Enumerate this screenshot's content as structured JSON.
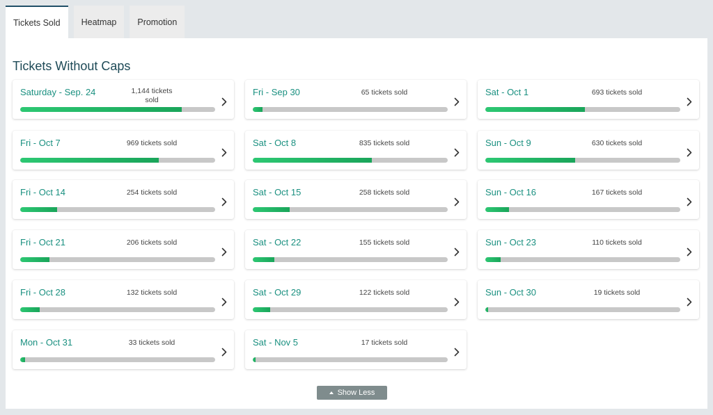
{
  "tabs": [
    {
      "label": "Tickets Sold",
      "active": true
    },
    {
      "label": "Heatmap",
      "active": false
    },
    {
      "label": "Promotion",
      "active": false
    }
  ],
  "section_title": "Tickets Without Caps",
  "colors": {
    "accent": "#1a9080",
    "bar_fill": "#22b865",
    "bar_track": "#c8c8c8",
    "button": "#7f8c8d"
  },
  "cards": [
    {
      "date": "Saturday - Sep. 24",
      "count_label": "1,144 tickets sold",
      "progress_pct": 83
    },
    {
      "date": "Fri - Sep 30",
      "count_label": "65 tickets sold",
      "progress_pct": 5
    },
    {
      "date": "Sat - Oct 1",
      "count_label": "693 tickets sold",
      "progress_pct": 51
    },
    {
      "date": "Fri - Oct 7",
      "count_label": "969 tickets sold",
      "progress_pct": 71
    },
    {
      "date": "Sat - Oct 8",
      "count_label": "835 tickets sold",
      "progress_pct": 61
    },
    {
      "date": "Sun - Oct 9",
      "count_label": "630 tickets sold",
      "progress_pct": 46
    },
    {
      "date": "Fri - Oct 14",
      "count_label": "254 tickets sold",
      "progress_pct": 19
    },
    {
      "date": "Sat - Oct 15",
      "count_label": "258 tickets sold",
      "progress_pct": 19
    },
    {
      "date": "Sun - Oct 16",
      "count_label": "167 tickets sold",
      "progress_pct": 12
    },
    {
      "date": "Fri - Oct 21",
      "count_label": "206 tickets sold",
      "progress_pct": 15
    },
    {
      "date": "Sat - Oct 22",
      "count_label": "155 tickets sold",
      "progress_pct": 11
    },
    {
      "date": "Sun - Oct 23",
      "count_label": "110 tickets sold",
      "progress_pct": 8
    },
    {
      "date": "Fri - Oct 28",
      "count_label": "132 tickets sold",
      "progress_pct": 10
    },
    {
      "date": "Sat - Oct 29",
      "count_label": "122 tickets sold",
      "progress_pct": 9
    },
    {
      "date": "Sun - Oct 30",
      "count_label": "19 tickets sold",
      "progress_pct": 1.4
    },
    {
      "date": "Mon - Oct 31",
      "count_label": "33 tickets sold",
      "progress_pct": 2.5
    },
    {
      "date": "Sat - Nov 5",
      "count_label": "17 tickets sold",
      "progress_pct": 1.3
    }
  ],
  "show_less_label": "Show Less",
  "icons": {
    "card_arrow": "chevron-right-icon",
    "collapse": "caret-up-icon"
  }
}
